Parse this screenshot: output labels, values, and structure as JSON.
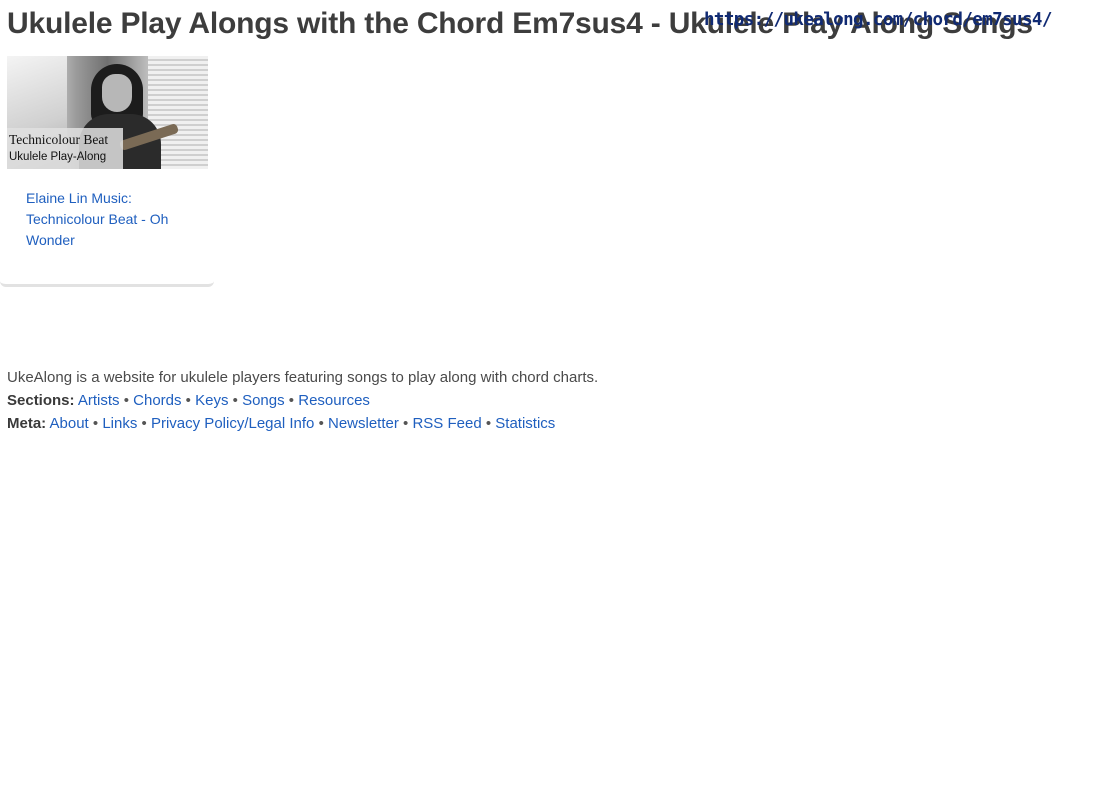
{
  "page": {
    "title": "Ukulele Play Alongs with the Chord Em7sus4 - Ukulele Play Along Songs",
    "url_overlay": "https://ukealong.com/chord/em7sus4/"
  },
  "card": {
    "thumbnail": {
      "caption_line1": "Technicolour Beat",
      "caption_line2": "Ukulele Play-Along"
    },
    "link_text": "Elaine Lin Music: Technicolour Beat - Oh Wonder"
  },
  "footer": {
    "description": "UkeAlong is a website for ukulele players featuring songs to play along with chord charts.",
    "sections_label": "Sections:",
    "sections": [
      "Artists",
      "Chords",
      "Keys",
      "Songs",
      "Resources"
    ],
    "meta_label": "Meta:",
    "meta": [
      "About",
      "Links",
      "Privacy Policy/Legal Info",
      "Newsletter",
      "RSS Feed",
      "Statistics"
    ],
    "separator": "•"
  },
  "colors": {
    "link": "#1f5fbf",
    "title": "#3d3d3d",
    "url_overlay": "#102a73"
  }
}
